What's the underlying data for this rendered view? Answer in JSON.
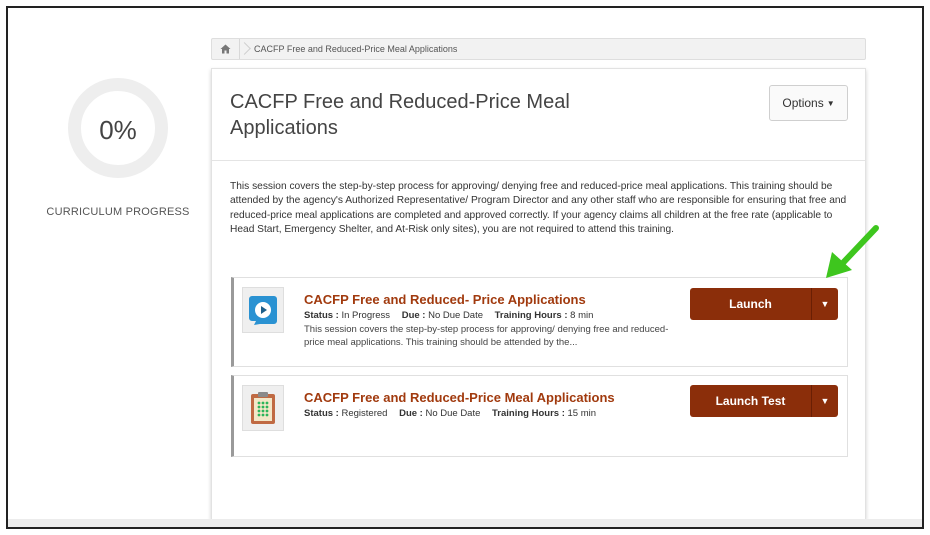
{
  "progress": {
    "percent": "0%",
    "label": "CURRICULUM PROGRESS"
  },
  "breadcrumb": {
    "home_icon": "home-icon",
    "current": "CACFP Free and Reduced-Price Meal Applications"
  },
  "header": {
    "title": "CACFP Free and Reduced-Price Meal Applications",
    "options_label": "Options"
  },
  "description": "This session covers the step-by-step process for approving/ denying free and reduced-price meal applications. This training should be attended by the agency's Authorized Representative/ Program Director and any other staff who are responsible for ensuring that free and reduced-price meal applications are completed and approved correctly. If your agency claims all children at the free rate (applicable to Head Start, Emergency Shelter, and At-Risk only sites), you are not required to attend this training.",
  "items": [
    {
      "icon": "video-play-icon",
      "title": "CACFP Free and Reduced- Price Applications",
      "status_label": "Status :",
      "status": "In Progress",
      "due_label": "Due :",
      "due": "No Due Date",
      "hours_label": "Training Hours :",
      "hours": "8 min",
      "desc": "This session covers the step-by-step process for approving/ denying free and reduced-price meal applications. This training should be attended by the...",
      "action": "Launch"
    },
    {
      "icon": "test-clipboard-icon",
      "title": "CACFP Free and Reduced-Price Meal Applications",
      "status_label": "Status :",
      "status": "Registered",
      "due_label": "Due :",
      "due": "No Due Date",
      "hours_label": "Training Hours :",
      "hours": "15 min",
      "action": "Launch Test"
    }
  ],
  "colors": {
    "accent": "#8b2e0a",
    "title_accent": "#a13a0e",
    "arrow": "#3ec61e"
  }
}
